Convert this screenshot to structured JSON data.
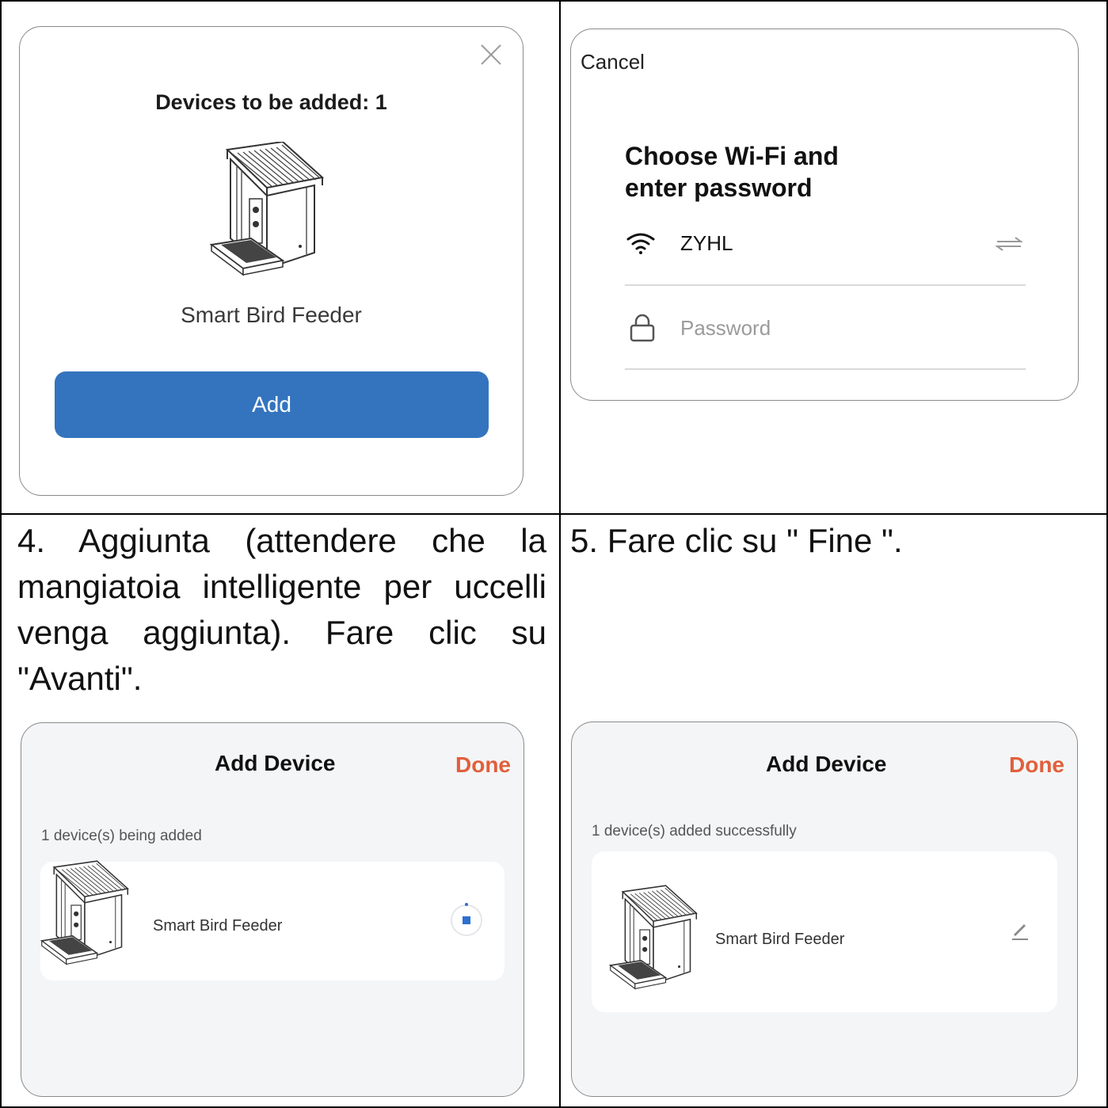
{
  "panel_confirm": {
    "title": "Devices to be added: 1",
    "device_name": "Smart Bird Feeder",
    "add_label": "Add"
  },
  "panel_wifi": {
    "cancel_label": "Cancel",
    "title_line1": "Choose Wi-Fi and",
    "title_line2": "enter password",
    "ssid": "ZYHL",
    "password_placeholder": "Password"
  },
  "step4": {
    "text": "4. Aggiunta (attendere che la mangiatoia intelligente per uccelli venga aggiunta). Fare clic su \"Avanti\"."
  },
  "step5": {
    "text": "5. Fare clic su \" Fine \"."
  },
  "panel_adding": {
    "title": "Add Device",
    "done_label": "Done",
    "status": "1 device(s) being added",
    "device_name": "Smart Bird Feeder"
  },
  "panel_added": {
    "title": "Add Device",
    "done_label": "Done",
    "status": "1 device(s) added successfully",
    "device_name": "Smart Bird Feeder"
  },
  "colors": {
    "accent_blue": "#3474be",
    "done_orange": "#e0603b"
  }
}
